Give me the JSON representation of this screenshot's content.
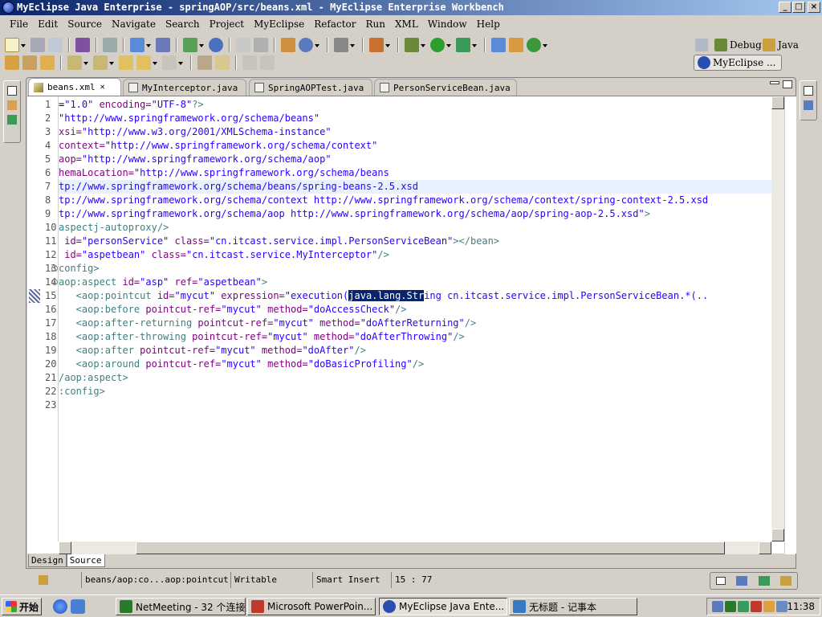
{
  "window": {
    "title": "MyEclipse Java Enterprise - springAOP/src/beans.xml - MyEclipse Enterprise Workbench",
    "minimize": "_",
    "maximize": "□",
    "close": "×"
  },
  "menu": [
    "File",
    "Edit",
    "Source",
    "Navigate",
    "Search",
    "Project",
    "MyEclipse",
    "Refactor",
    "Run",
    "XML",
    "Window",
    "Help"
  ],
  "perspectives": {
    "debug": "Debug",
    "java": "Java",
    "myeclipse": "MyEclipse ..."
  },
  "tabs": [
    {
      "label": "beans.xml",
      "close": "✕"
    },
    {
      "label": "MyInterceptor.java"
    },
    {
      "label": "SpringAOPTest.java"
    },
    {
      "label": "PersonServiceBean.java"
    }
  ],
  "line_numbers": [
    "1",
    "2",
    "3",
    "4",
    "5",
    "6",
    "7",
    "8",
    "9",
    "10",
    "11",
    "12",
    "13",
    "14",
    "15",
    "16",
    "17",
    "18",
    "19",
    "20",
    "21",
    "22",
    "23"
  ],
  "code": [
    [
      {
        "t": "=",
        "c": "txt"
      },
      {
        "t": "\"1.0\"",
        "c": "str"
      },
      {
        "t": " encoding=",
        "c": "attr"
      },
      {
        "t": "\"UTF-8\"",
        "c": "str"
      },
      {
        "t": "?>",
        "c": "tag"
      }
    ],
    [
      {
        "t": "\"http://www.springframework.org/schema/beans\"",
        "c": "str"
      }
    ],
    [
      {
        "t": "xsi=",
        "c": "attr"
      },
      {
        "t": "\"http://www.w3.org/2001/XMLSchema-instance\"",
        "c": "str"
      }
    ],
    [
      {
        "t": "context=",
        "c": "attr"
      },
      {
        "t": "\"http://www.springframework.org/schema/context\"",
        "c": "str"
      }
    ],
    [
      {
        "t": "aop=",
        "c": "attr"
      },
      {
        "t": "\"http://www.springframework.org/schema/aop\"",
        "c": "str"
      }
    ],
    [
      {
        "t": "hemaLocation=",
        "c": "attr"
      },
      {
        "t": "\"http://www.springframework.org/schema/beans",
        "c": "str"
      }
    ],
    [
      {
        "t": "tp://www.springframework.org/schema/beans/spring-beans-2.5.xsd",
        "c": "str"
      }
    ],
    [
      {
        "t": "tp://www.springframework.org/schema/context http://www.springframework.org/schema/context/spring-context-2.5.xsd",
        "c": "str"
      }
    ],
    [
      {
        "t": "tp://www.springframework.org/schema/aop http://www.springframework.org/schema/aop/spring-aop-2.5.xsd\"",
        "c": "str"
      },
      {
        "t": ">",
        "c": "tag"
      }
    ],
    [
      {
        "t": "aspectj-autoproxy/>",
        "c": "tag"
      }
    ],
    [
      {
        "t": " id=",
        "c": "attr"
      },
      {
        "t": "\"personService\"",
        "c": "str"
      },
      {
        "t": " class=",
        "c": "attr"
      },
      {
        "t": "\"cn.itcast.service.impl.PersonServiceBean\"",
        "c": "str"
      },
      {
        "t": "></bean>",
        "c": "tag"
      }
    ],
    [
      {
        "t": " id=",
        "c": "attr"
      },
      {
        "t": "\"aspetbean\"",
        "c": "str"
      },
      {
        "t": " class=",
        "c": "attr"
      },
      {
        "t": "\"cn.itcast.service.MyInterceptor\"",
        "c": "str"
      },
      {
        "t": "/>",
        "c": "tag"
      }
    ],
    [
      {
        "t": "config>",
        "c": "tag"
      }
    ],
    [
      {
        "t": "aop:aspect",
        "c": "tag"
      },
      {
        "t": " id=",
        "c": "attr"
      },
      {
        "t": "\"asp\"",
        "c": "str"
      },
      {
        "t": " ref=",
        "c": "attr"
      },
      {
        "t": "\"aspetbean\"",
        "c": "str"
      },
      {
        "t": ">",
        "c": "tag"
      }
    ],
    [
      {
        "t": "   <aop:pointcut",
        "c": "tag"
      },
      {
        "t": " id=",
        "c": "attr"
      },
      {
        "t": "\"mycut\"",
        "c": "str"
      },
      {
        "t": " expression=",
        "c": "attr"
      },
      {
        "t": "\"execution(",
        "c": "str"
      },
      {
        "t": "java.lang.Str",
        "c": "sel"
      },
      {
        "t": "ing cn.itcast.service.impl.PersonServiceBean.*(..",
        "c": "str"
      }
    ],
    [
      {
        "t": "   <aop:before",
        "c": "tag"
      },
      {
        "t": " pointcut-ref=",
        "c": "attr"
      },
      {
        "t": "\"mycut\"",
        "c": "str"
      },
      {
        "t": " method=",
        "c": "attr"
      },
      {
        "t": "\"doAccessCheck\"",
        "c": "str"
      },
      {
        "t": "/>",
        "c": "tag"
      }
    ],
    [
      {
        "t": "   <aop:after-returning",
        "c": "tag"
      },
      {
        "t": " pointcut-ref=",
        "c": "attr"
      },
      {
        "t": "\"mycut\"",
        "c": "str"
      },
      {
        "t": " method=",
        "c": "attr"
      },
      {
        "t": "\"doAfterReturning\"",
        "c": "str"
      },
      {
        "t": "/>",
        "c": "tag"
      }
    ],
    [
      {
        "t": "   <aop:after-throwing",
        "c": "tag"
      },
      {
        "t": " pointcut-ref=",
        "c": "attr"
      },
      {
        "t": "\"mycut\"",
        "c": "str"
      },
      {
        "t": " method=",
        "c": "attr"
      },
      {
        "t": "\"doAfterThrowing\"",
        "c": "str"
      },
      {
        "t": "/>",
        "c": "tag"
      }
    ],
    [
      {
        "t": "   <aop:after",
        "c": "tag"
      },
      {
        "t": " pointcut-ref=",
        "c": "attr"
      },
      {
        "t": "\"mycut\"",
        "c": "str"
      },
      {
        "t": " method=",
        "c": "attr"
      },
      {
        "t": "\"doAfter\"",
        "c": "str"
      },
      {
        "t": "/>",
        "c": "tag"
      }
    ],
    [
      {
        "t": "   <aop:around",
        "c": "tag"
      },
      {
        "t": " pointcut-ref=",
        "c": "attr"
      },
      {
        "t": "\"mycut\"",
        "c": "str"
      },
      {
        "t": " method=",
        "c": "attr"
      },
      {
        "t": "\"doBasicProfiling\"",
        "c": "str"
      },
      {
        "t": "/>",
        "c": "tag"
      }
    ],
    [
      {
        "t": "/aop:aspect>",
        "c": "tag"
      }
    ],
    [
      {
        "t": ":config>",
        "c": "tag"
      }
    ],
    []
  ],
  "editor_bottom_tabs": [
    "Design",
    "Source"
  ],
  "status": {
    "breadcrumb": "beans/aop:co...aop:pointcut",
    "mode": "Writable",
    "insert": "Smart Insert",
    "position": "15 : 77"
  },
  "taskbar": {
    "start": "开始",
    "tasks": [
      {
        "label": "NetMeeting - 32 个连接",
        "color": "#2b7a2b"
      },
      {
        "label": "Microsoft PowerPoin...",
        "color": "#c0392b"
      },
      {
        "label": "MyEclipse Java Ente...",
        "color": "#2a4db0"
      },
      {
        "label": "无标题 - 记事本",
        "color": "#3a78c4"
      }
    ],
    "clock": "11:38"
  }
}
